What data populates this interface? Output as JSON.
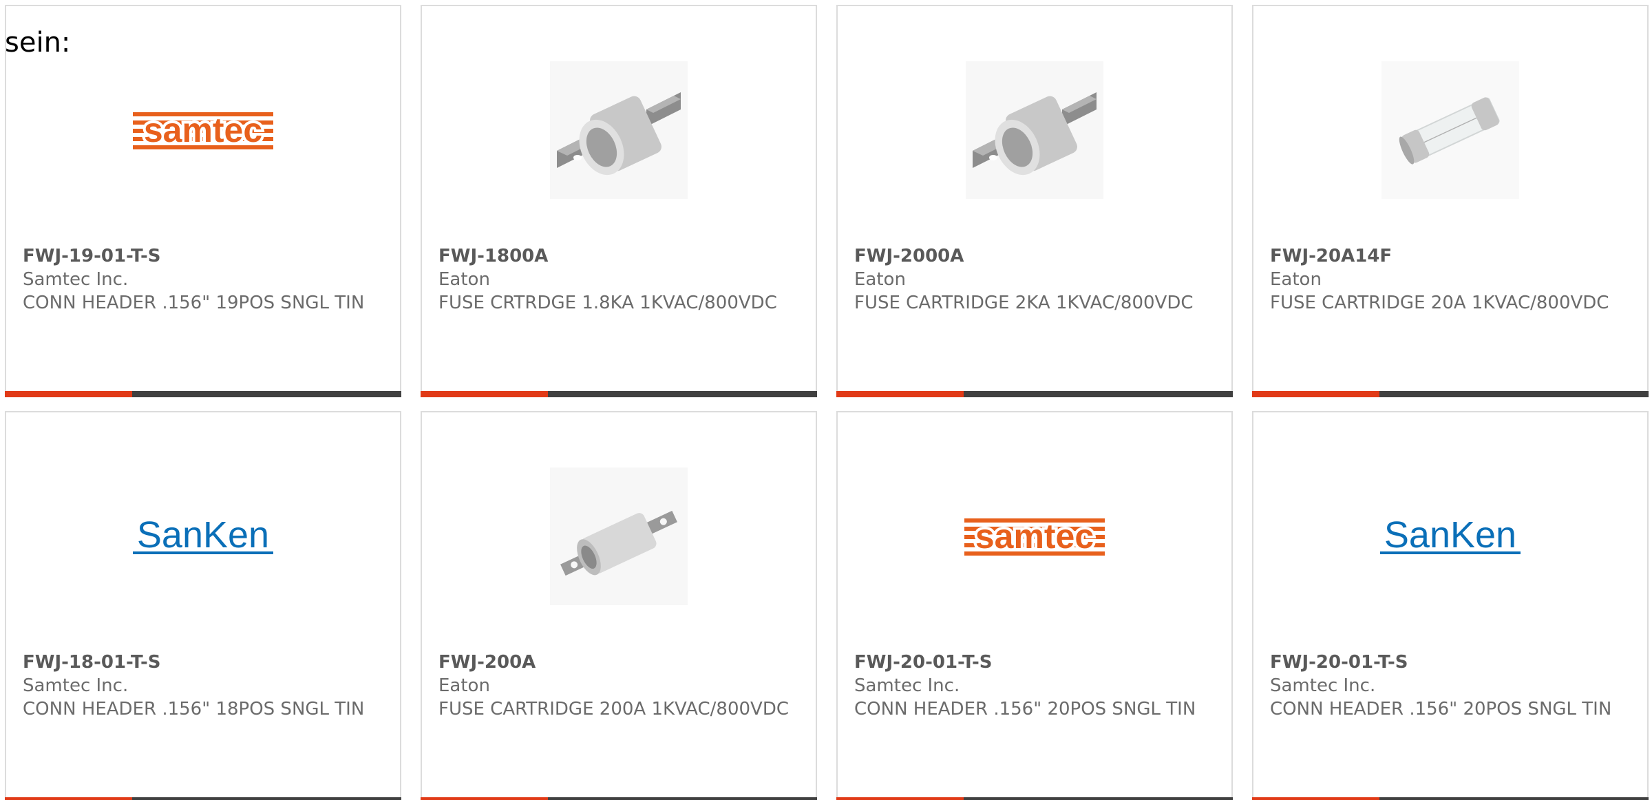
{
  "prefix_text": "sein:",
  "colors": {
    "accent": "#e13a17",
    "bar_dark": "#404040",
    "card_border": "#dcdcdc",
    "text": "#6b6b6b",
    "samtec_orange": "#e8601c",
    "sanken_blue": "#0a6fb8"
  },
  "cards": [
    {
      "part_number": "FWJ-19-01-T-S",
      "manufacturer": "Samtec Inc.",
      "description": "CONN HEADER .156\" 19POS SNGL TIN",
      "image": "samtec-logo",
      "logo_text": "samtec"
    },
    {
      "part_number": "FWJ-1800A",
      "manufacturer": "Eaton",
      "description": "FUSE CRTRDGE 1.8KA 1KVAC/800VDC",
      "image": "fuse-bolt-large-icon"
    },
    {
      "part_number": "FWJ-2000A",
      "manufacturer": "Eaton",
      "description": "FUSE CARTRIDGE 2KA 1KVAC/800VDC",
      "image": "fuse-bolt-large-icon"
    },
    {
      "part_number": "FWJ-20A14F",
      "manufacturer": "Eaton",
      "description": "FUSE CARTRIDGE 20A 1KVAC/800VDC",
      "image": "fuse-glass-cartridge-icon"
    },
    {
      "part_number": "FWJ-18-01-T-S",
      "manufacturer": "Samtec Inc.",
      "description": "CONN HEADER .156\" 18POS SNGL TIN",
      "image": "sanken-logo",
      "logo_text": "SanKen"
    },
    {
      "part_number": "FWJ-200A",
      "manufacturer": "Eaton",
      "description": "FUSE CARTRIDGE 200A 1KVAC/800VDC",
      "image": "fuse-bolt-small-icon"
    },
    {
      "part_number": "FWJ-20-01-T-S",
      "manufacturer": "Samtec Inc.",
      "description": "CONN HEADER .156\" 20POS SNGL TIN",
      "image": "samtec-logo",
      "logo_text": "samtec"
    },
    {
      "part_number": "FWJ-20-01-T-S",
      "manufacturer": "Samtec Inc.",
      "description": "CONN HEADER .156\" 20POS SNGL TIN",
      "image": "sanken-logo",
      "logo_text": "SanKen"
    }
  ]
}
